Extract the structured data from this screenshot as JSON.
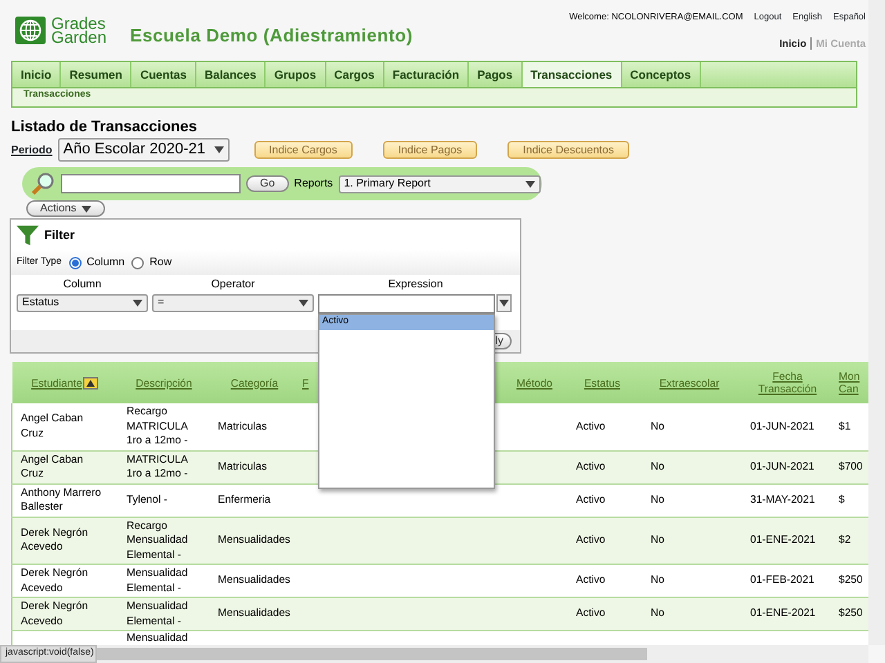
{
  "header": {
    "logo": {
      "line1": "Grades",
      "line2": "Garden"
    },
    "school_title": "Escuela Demo (Adiestramiento)",
    "welcome": "Welcome: NCOLONRIVERA@EMAIL.COM",
    "top_links": [
      "Logout",
      "English",
      "Español"
    ],
    "account_links": [
      {
        "label": "Inicio",
        "selected": true
      },
      {
        "label": "Mi Cuenta",
        "selected": false
      }
    ]
  },
  "nav": {
    "tabs": [
      {
        "label": "Inicio",
        "selected": false
      },
      {
        "label": "Resumen",
        "selected": false
      },
      {
        "label": "Cuentas",
        "selected": false
      },
      {
        "label": "Balances",
        "selected": false
      },
      {
        "label": "Grupos",
        "selected": false
      },
      {
        "label": "Cargos",
        "selected": false
      },
      {
        "label": "Facturación",
        "selected": false
      },
      {
        "label": "Pagos",
        "selected": false
      },
      {
        "label": "Transacciones",
        "selected": true
      },
      {
        "label": "Conceptos",
        "selected": false
      }
    ],
    "subnav": "Transacciones"
  },
  "page_title": "Listado de Transacciones",
  "period": {
    "label": "Periodo",
    "value": "Año Escolar 2020-21"
  },
  "index_buttons": [
    "Indice Cargos",
    "Indice Pagos",
    "Indice Descuentos"
  ],
  "search": {
    "go": "Go",
    "reports_label": "Reports",
    "report_value": "1. Primary Report"
  },
  "actions": "Actions",
  "filter": {
    "title": "Filter",
    "type_label": "Filter Type",
    "types": [
      {
        "label": "Column",
        "selected": true
      },
      {
        "label": "Row",
        "selected": false
      }
    ],
    "headings": [
      "Column",
      "Operator",
      "Expression"
    ],
    "column_value": "Estatus",
    "operator_value": "=",
    "apply": "ly",
    "options": [
      {
        "label": "Activo",
        "selected": true
      }
    ]
  },
  "table": {
    "columns": [
      {
        "label": "Estudiante",
        "sorted": true
      },
      {
        "label": "Descripción",
        "sorted": false
      },
      {
        "label": "Categoría",
        "sorted": false
      },
      {
        "label": "F",
        "sorted": false
      },
      {
        "label": "Método",
        "sorted": false
      },
      {
        "label": "Estatus",
        "sorted": false
      },
      {
        "label": "Extraescolar",
        "sorted": false
      },
      {
        "label": "Fecha Transacción",
        "sorted": false
      },
      {
        "label": "Mon Can",
        "sorted": false
      }
    ],
    "rows": [
      [
        "Angel Caban Cruz",
        "Recargo MATRICULA 1ro a 12mo -",
        "Matriculas",
        "",
        "",
        "Activo",
        "No",
        "01-JUN-2021",
        "$1"
      ],
      [
        "Angel Caban Cruz",
        "MATRICULA 1ro a 12mo -",
        "Matriculas",
        "",
        "",
        "Activo",
        "No",
        "01-JUN-2021",
        "$700"
      ],
      [
        "Anthony Marrero Ballester",
        "Tylenol -",
        "Enfermeria",
        "",
        "",
        "Activo",
        "No",
        "31-MAY-2021",
        "$"
      ],
      [
        "Derek Negrón Acevedo",
        "Recargo Mensualidad Elemental -",
        "Mensualidades",
        "",
        "",
        "Activo",
        "No",
        "01-ENE-2021",
        "$2"
      ],
      [
        "Derek Negrón Acevedo",
        "Mensualidad Elemental -",
        "Mensualidades",
        "",
        "",
        "Activo",
        "No",
        "01-FEB-2021",
        "$250"
      ],
      [
        "Derek Negrón Acevedo",
        "Mensualidad Elemental -",
        "Mensualidades",
        "",
        "",
        "Activo",
        "No",
        "01-ENE-2021",
        "$250"
      ],
      [
        "",
        "Mensualidad",
        "",
        "",
        "",
        "",
        "",
        "",
        ""
      ]
    ]
  },
  "status_bar": "javascript:void(false)"
}
